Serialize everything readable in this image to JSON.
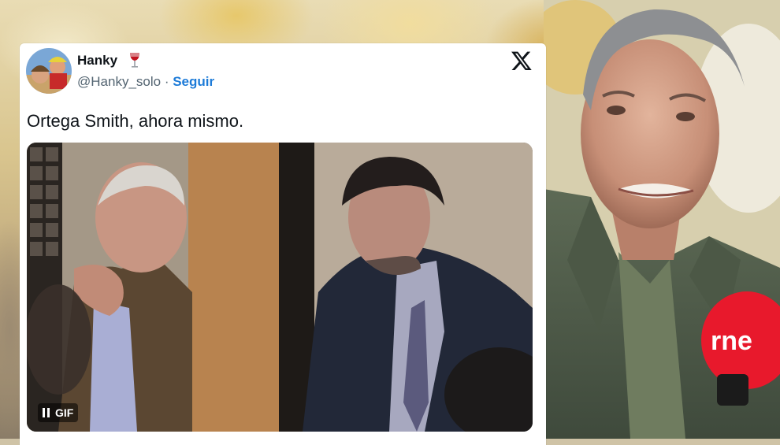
{
  "tweet": {
    "display_name": "Hanky",
    "emoji_icon": "wine-glass-icon",
    "handle": "@Hanky_solo",
    "separator": " · ",
    "follow_label": "Seguir",
    "text": "Ortega Smith, ahora mismo.",
    "media": {
      "badge_label": "GIF",
      "badge_icon": "pause-icon"
    }
  },
  "brand_icon": "x-logo-icon",
  "microphone": {
    "label": "rne",
    "color": "#e8192c"
  },
  "colors": {
    "follow_link": "#1d7bd8",
    "text_primary": "#0f1419",
    "text_secondary": "#536471"
  }
}
